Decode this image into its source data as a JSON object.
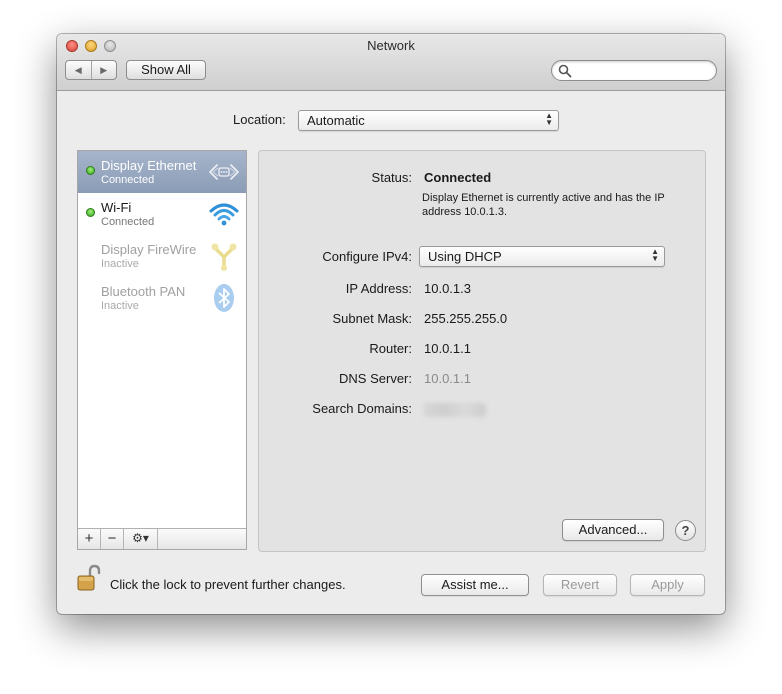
{
  "window": {
    "title": "Network",
    "nav": {
      "back_icon": "◀",
      "forward_icon": "▶"
    },
    "show_all_label": "Show All",
    "search": {
      "placeholder": "",
      "value": ""
    }
  },
  "location": {
    "label": "Location:",
    "value": "Automatic"
  },
  "services": [
    {
      "name": "Display Ethernet",
      "status": "Connected",
      "icon": "ethernet-icon",
      "selected": true,
      "active": true
    },
    {
      "name": "Wi-Fi",
      "status": "Connected",
      "icon": "wifi-icon",
      "selected": false,
      "active": true
    },
    {
      "name": "Display FireWire",
      "status": "Inactive",
      "icon": "firewire-icon",
      "selected": false,
      "active": false
    },
    {
      "name": "Bluetooth PAN",
      "status": "Inactive",
      "icon": "bluetooth-icon",
      "selected": false,
      "active": false
    }
  ],
  "sidebar_toolbar": {
    "add": "+",
    "remove": "−",
    "action": "⚙▾"
  },
  "detail": {
    "status_label": "Status:",
    "status_value": "Connected",
    "status_description": "Display Ethernet is currently active and has the IP address 10.0.1.3.",
    "configure_label": "Configure IPv4:",
    "configure_value": "Using DHCP",
    "ip_label": "IP Address:",
    "ip_value": "10.0.1.3",
    "subnet_label": "Subnet Mask:",
    "subnet_value": "255.255.255.0",
    "router_label": "Router:",
    "router_value": "10.0.1.1",
    "dns_label": "DNS Server:",
    "dns_value": "10.0.1.1",
    "search_domains_label": "Search Domains:",
    "advanced_label": "Advanced...",
    "help_label": "?"
  },
  "footer": {
    "lock_text": "Click the lock to prevent further changes.",
    "assist_label": "Assist me...",
    "revert_label": "Revert",
    "apply_label": "Apply"
  },
  "colors": {
    "selection": "#8b9cb6",
    "status_green": "#37a51b",
    "wifi_blue": "#2f8fd8",
    "bluetooth_blue": "#5aa7e8",
    "firewire_yellow": "#e8d36a"
  }
}
